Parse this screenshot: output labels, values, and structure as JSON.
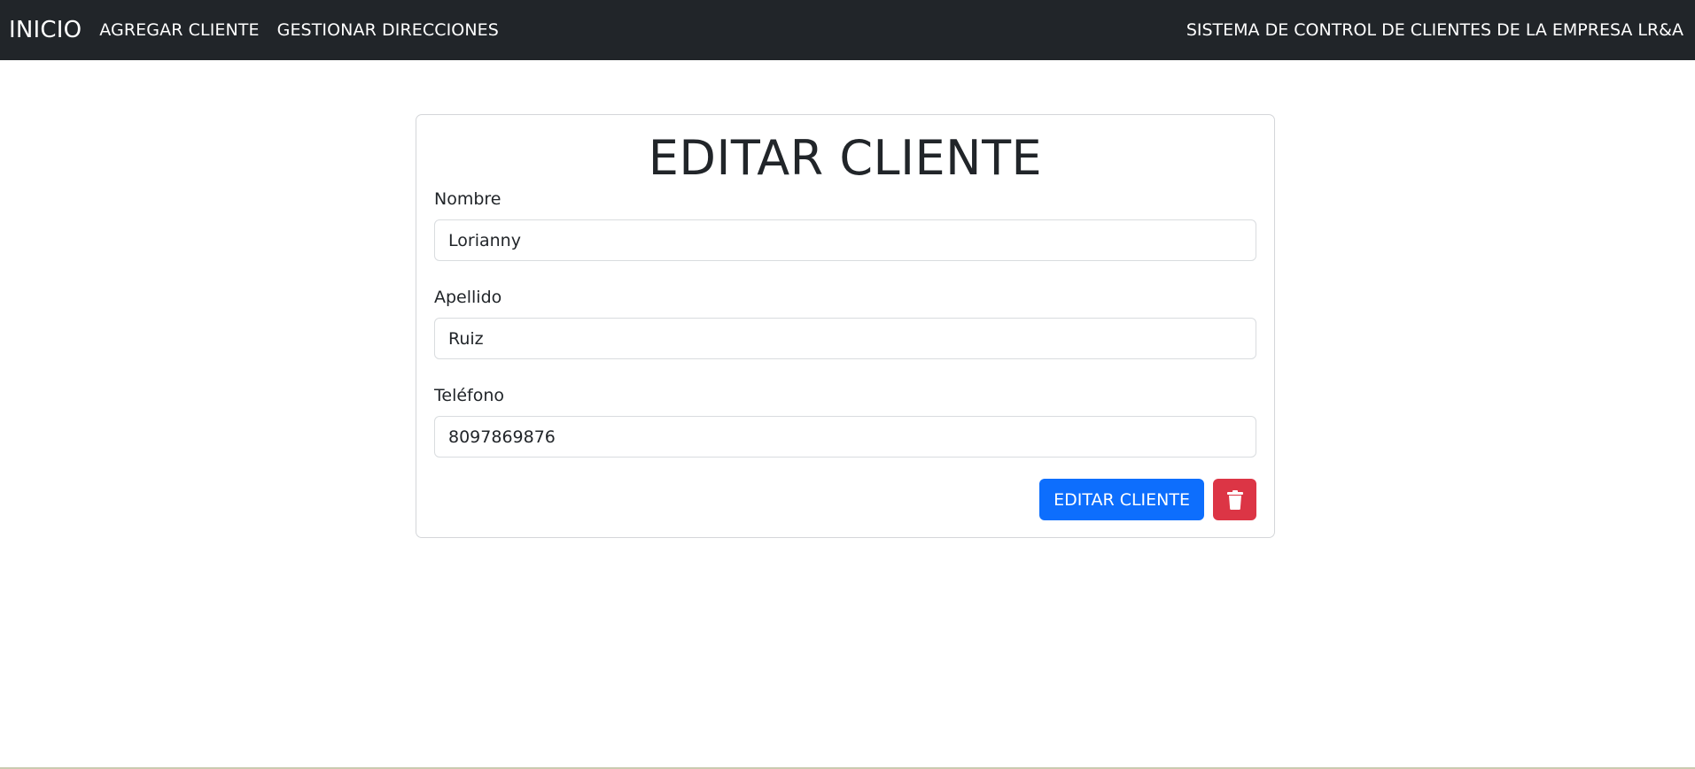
{
  "navbar": {
    "brand": "INICIO",
    "links": [
      {
        "label": "AGREGAR CLIENTE"
      },
      {
        "label": "GESTIONAR DIRECCIONES"
      }
    ],
    "right_text": "SISTEMA DE CONTROL DE CLIENTES DE LA EMPRESA LR&A"
  },
  "form": {
    "title": "EDITAR CLIENTE",
    "fields": [
      {
        "label": "Nombre",
        "value": "Lorianny"
      },
      {
        "label": "Apellido",
        "value": "Ruiz"
      },
      {
        "label": "Teléfono",
        "value": "8097869876"
      }
    ],
    "submit_label": "EDITAR CLIENTE",
    "delete_icon": "trash-icon"
  },
  "colors": {
    "navbar_bg": "#212529",
    "primary": "#0d6efd",
    "danger": "#dc3545"
  }
}
